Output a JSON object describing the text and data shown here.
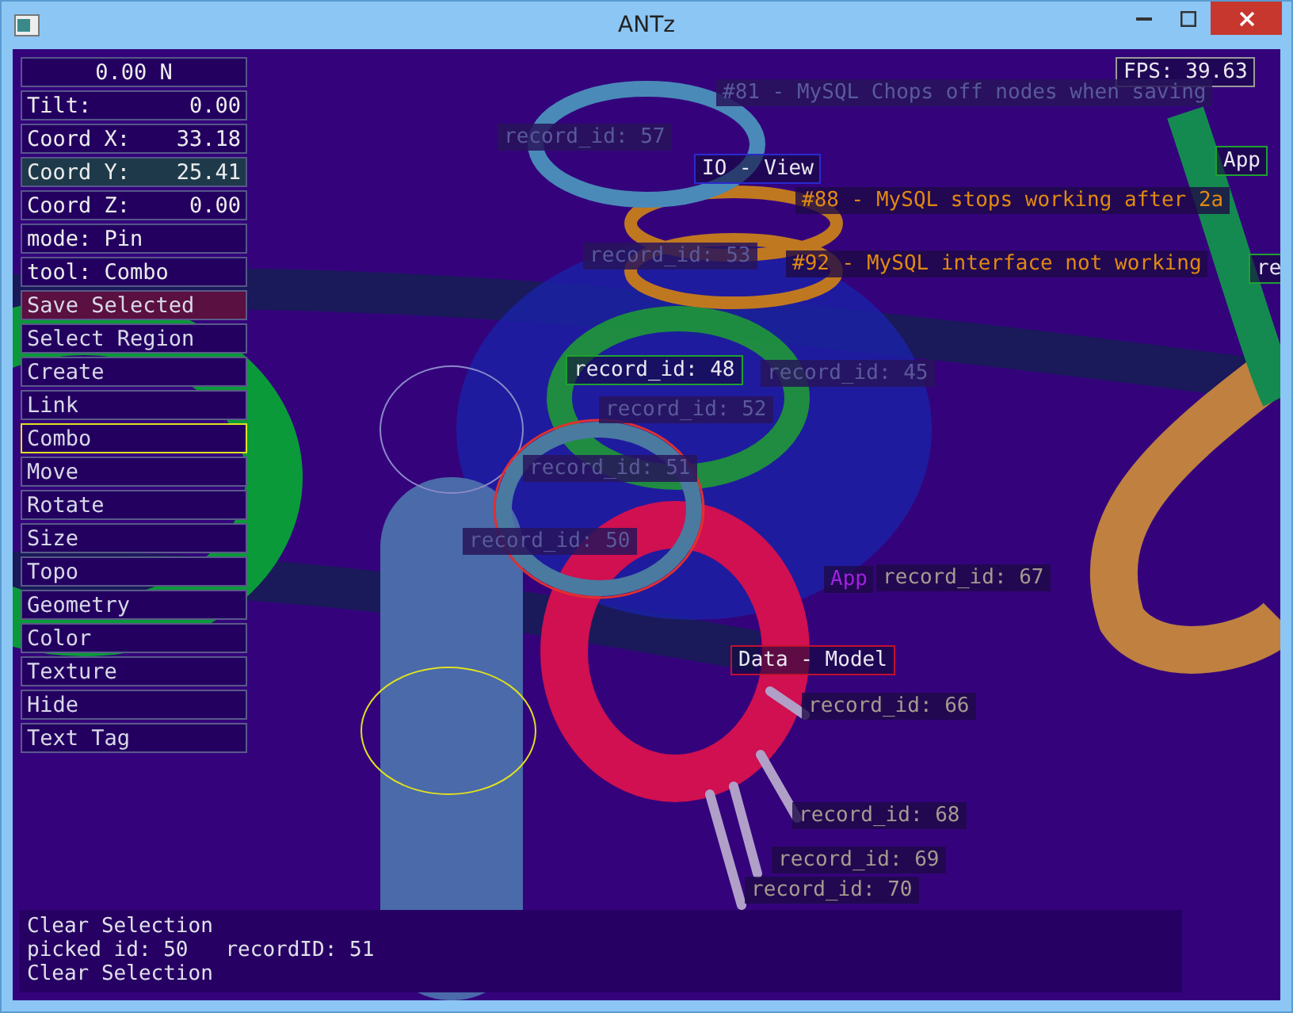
{
  "window": {
    "title": "ANTz"
  },
  "panel": [
    {
      "text": "0.00 N",
      "kind": "readout",
      "selected": false,
      "color": "#230060"
    },
    {
      "text": "Tilt:",
      "value": "0.00",
      "kind": "readout",
      "selected": false,
      "color": "#230060"
    },
    {
      "text": "Coord X:",
      "value": "33.18",
      "kind": "readout",
      "selected": false,
      "color": "#230060"
    },
    {
      "text": "Coord Y:",
      "value": "25.41",
      "kind": "readout",
      "selected": false,
      "color": "#1e3a4a"
    },
    {
      "text": "Coord Z:",
      "value": "0.00",
      "kind": "readout",
      "selected": false,
      "color": "#230060"
    },
    {
      "text": "mode: Pin",
      "kind": "readout",
      "selected": false,
      "color": "#230060"
    },
    {
      "text": "tool: Combo",
      "kind": "readout",
      "selected": false,
      "color": "#230060"
    },
    {
      "text": "Save Selected",
      "kind": "button",
      "selected": false,
      "color": "#5a1040"
    },
    {
      "text": "Select Region",
      "kind": "button",
      "selected": false,
      "color": "#230060"
    },
    {
      "text": "Create",
      "kind": "button",
      "selected": false,
      "color": "#230060"
    },
    {
      "text": "Link",
      "kind": "button",
      "selected": false,
      "color": "#230060"
    },
    {
      "text": "Combo",
      "kind": "button",
      "selected": true,
      "color": "#230060"
    },
    {
      "text": "Move",
      "kind": "button",
      "selected": false,
      "color": "#230060"
    },
    {
      "text": "Rotate",
      "kind": "button",
      "selected": false,
      "color": "#230060"
    },
    {
      "text": "Size",
      "kind": "button",
      "selected": false,
      "color": "#230060"
    },
    {
      "text": "Topo",
      "kind": "button",
      "selected": false,
      "color": "#230060"
    },
    {
      "text": "Geometry",
      "kind": "button",
      "selected": false,
      "color": "#230060"
    },
    {
      "text": "Color",
      "kind": "button",
      "selected": false,
      "color": "#230060"
    },
    {
      "text": "Texture",
      "kind": "button",
      "selected": false,
      "color": "#230060"
    },
    {
      "text": "Hide",
      "kind": "button",
      "selected": false,
      "color": "#230060"
    },
    {
      "text": "Text Tag",
      "kind": "button",
      "selected": false,
      "color": "#230060"
    }
  ],
  "labels": [
    {
      "text": "FPS: 39.63",
      "kind": "tag",
      "color": "#9a9a9a"
    },
    {
      "text": "#81 - MySQL Chops off nodes when saving",
      "kind": "faded"
    },
    {
      "text": "record_id: 57",
      "kind": "faded"
    },
    {
      "text": "IO - View",
      "kind": "tag",
      "color": "#2a2ad0"
    },
    {
      "text": "App",
      "kind": "tag",
      "color": "#20a030"
    },
    {
      "text": "#88 - MySQL stops working after 2a",
      "kind": "issue"
    },
    {
      "text": "#92 - MySQL interface not working",
      "kind": "issue"
    },
    {
      "text": "re",
      "kind": "tag",
      "color": "#20a030"
    },
    {
      "text": "record_id: 53",
      "kind": "faded"
    },
    {
      "text": "record_id: 48",
      "kind": "tag",
      "color": "#20a030"
    },
    {
      "text": "record_id: 45",
      "kind": "faded"
    },
    {
      "text": "record_id: 52",
      "kind": "faded"
    },
    {
      "text": "record_id: 51",
      "kind": "faded"
    },
    {
      "text": "record_id: 50",
      "kind": "faded"
    },
    {
      "text": "App",
      "kind": "accent"
    },
    {
      "text": "record_id: 67",
      "kind": "plain"
    },
    {
      "text": "Data - Model",
      "kind": "tag",
      "color": "#c01030"
    },
    {
      "text": "record_id: 66",
      "kind": "plain"
    },
    {
      "text": "record_id: 68",
      "kind": "plain"
    },
    {
      "text": "record_id: 69",
      "kind": "plain"
    },
    {
      "text": "record_id: 70",
      "kind": "plain"
    }
  ],
  "console": [
    "Clear Selection",
    "picked id: 50   recordID: 51",
    "Clear Selection"
  ]
}
